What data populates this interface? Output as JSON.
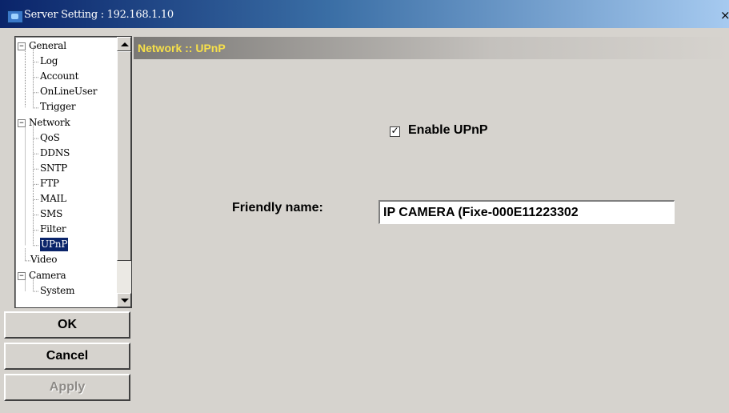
{
  "window": {
    "title": "Server Setting : 192.168.1.10",
    "close_glyph": "×",
    "icons": {
      "app": "server-setting-icon",
      "close": "close-icon"
    }
  },
  "tree": {
    "items": [
      {
        "label": "General",
        "type": "group",
        "expanded": true,
        "expander": "−"
      },
      {
        "label": "Log",
        "type": "leaf"
      },
      {
        "label": "Account",
        "type": "leaf"
      },
      {
        "label": "OnLineUser",
        "type": "leaf"
      },
      {
        "label": "Trigger",
        "type": "leaf"
      },
      {
        "label": "Network",
        "type": "group",
        "expanded": true,
        "expander": "−"
      },
      {
        "label": "QoS",
        "type": "leaf"
      },
      {
        "label": "DDNS",
        "type": "leaf"
      },
      {
        "label": "SNTP",
        "type": "leaf"
      },
      {
        "label": "FTP",
        "type": "leaf"
      },
      {
        "label": "MAIL",
        "type": "leaf"
      },
      {
        "label": "SMS",
        "type": "leaf"
      },
      {
        "label": "Filter",
        "type": "leaf"
      },
      {
        "label": "UPnP",
        "type": "leaf",
        "selected": true
      },
      {
        "label": "Video",
        "type": "group-leaf"
      },
      {
        "label": "Camera",
        "type": "group",
        "expanded": true,
        "expander": "−"
      },
      {
        "label": "System",
        "type": "leaf"
      }
    ],
    "scrollbar": {
      "icons": [
        "scroll-up-arrow-icon",
        "scroll-down-arrow-icon"
      ]
    }
  },
  "buttons": {
    "ok": "OK",
    "cancel": "Cancel",
    "apply": "Apply"
  },
  "content": {
    "title": "Network :: UPnP",
    "title_color": "#f7e04a",
    "enable_upnp": {
      "label": "Enable UPnP",
      "checked": true,
      "check_glyph": "✓"
    },
    "friendly_name": {
      "label": "Friendly name:",
      "value": "IP CAMERA (Fixe-000E11223302"
    }
  },
  "colors": {
    "titlebar_start": "#0a246a",
    "titlebar_end": "#a6caf0",
    "selection": "#0a246a",
    "window_face": "#d6d3ce"
  }
}
